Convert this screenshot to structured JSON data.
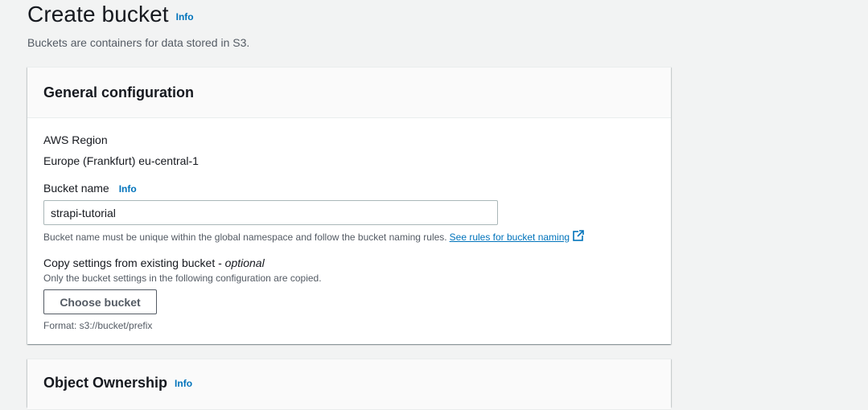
{
  "header": {
    "title": "Create bucket",
    "info_label": "Info",
    "description": "Buckets are containers for data stored in S3."
  },
  "general": {
    "title": "General configuration",
    "region": {
      "label": "AWS Region",
      "value": "Europe (Frankfurt) eu-central-1"
    },
    "bucket_name": {
      "label": "Bucket name",
      "info_label": "Info",
      "value": "strapi-tutorial",
      "constraint_text": "Bucket name must be unique within the global namespace and follow the bucket naming rules.",
      "rules_link": "See rules for bucket naming"
    },
    "copy_settings": {
      "label": "Copy settings from existing bucket - ",
      "optional": "optional",
      "description": "Only the bucket settings in the following configuration are copied.",
      "button_label": "Choose bucket",
      "format_hint": "Format: s3://bucket/prefix"
    }
  },
  "ownership": {
    "title": "Object Ownership",
    "info_label": "Info"
  },
  "colors": {
    "link": "#0073bb",
    "background": "#f2f3f3",
    "text": "#16191f",
    "secondary_text": "#545b64"
  },
  "icons": {
    "external_link": "external-link-icon"
  }
}
